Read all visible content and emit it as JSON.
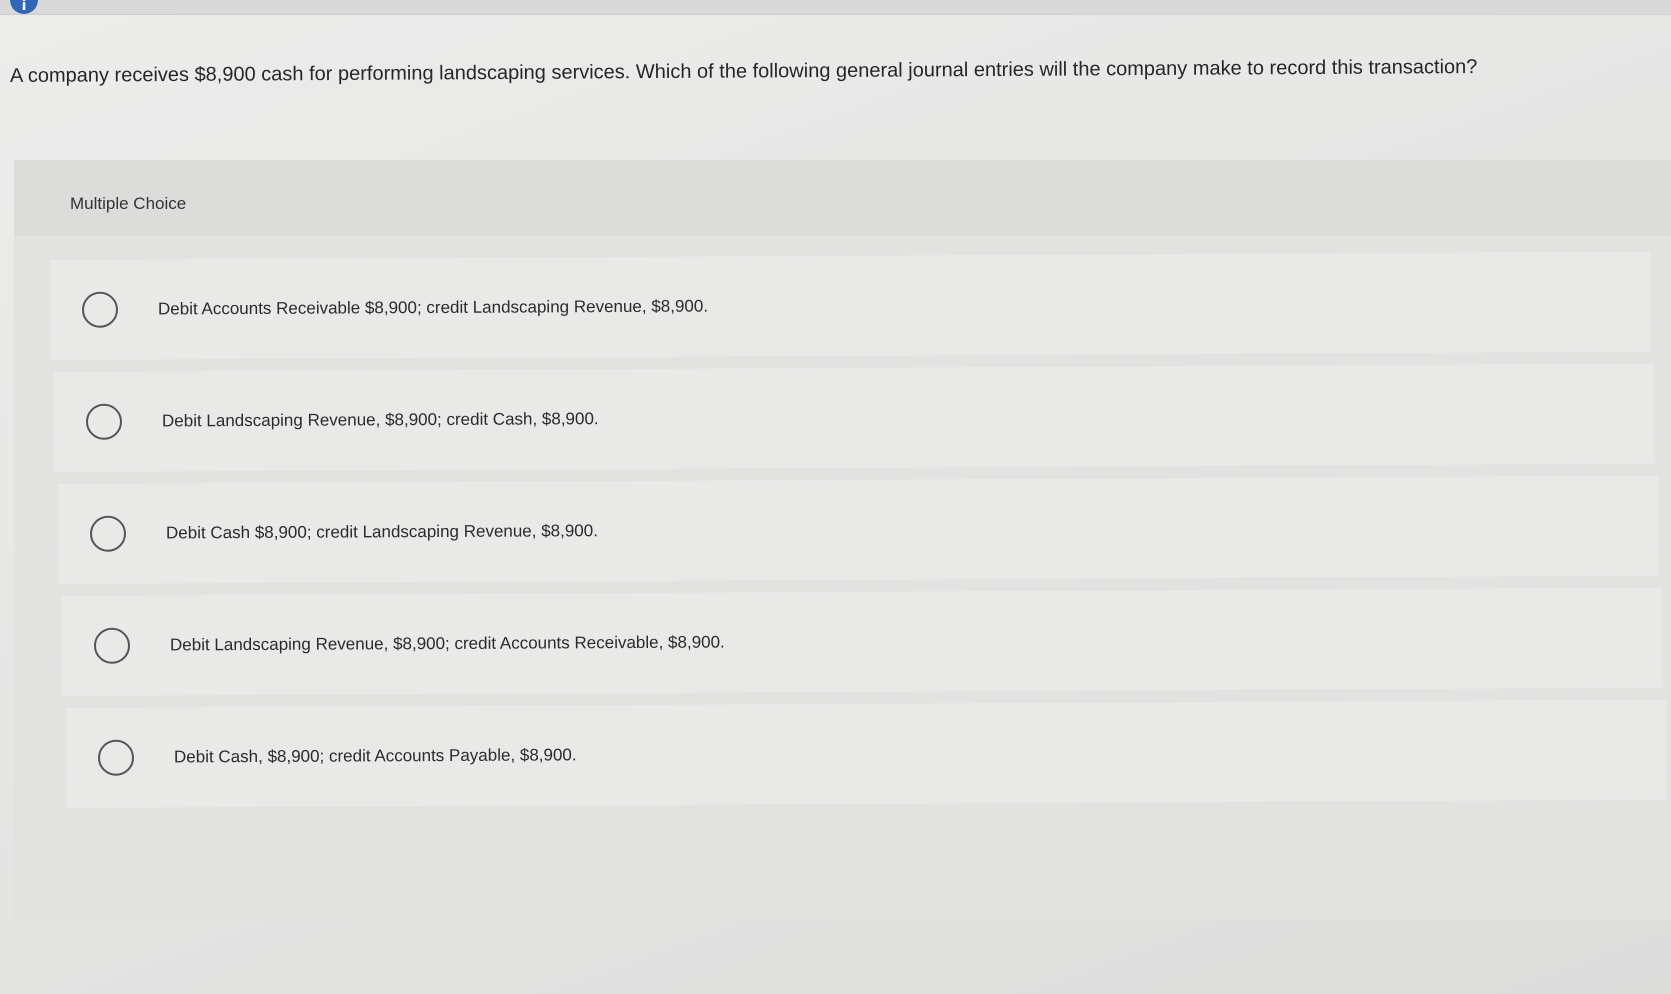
{
  "question": {
    "text": "A company receives $8,900 cash for performing landscaping services. Which of the following general journal entries will the company make to record this transaction?"
  },
  "panel": {
    "heading": "Multiple Choice"
  },
  "choices": [
    {
      "label": "Debit Accounts Receivable $8,900; credit Landscaping Revenue, $8,900."
    },
    {
      "label": "Debit Landscaping Revenue, $8,900; credit Cash, $8,900."
    },
    {
      "label": "Debit Cash $8,900; credit Landscaping Revenue, $8,900."
    },
    {
      "label": "Debit Landscaping Revenue, $8,900; credit Accounts Receivable, $8,900."
    },
    {
      "label": "Debit Cash, $8,900; credit Accounts Payable, $8,900."
    }
  ],
  "colors": {
    "info_icon": "#2f66b8",
    "background": "#e6e6e5"
  },
  "icons": {
    "info": "info-icon",
    "radio": "radio-button"
  }
}
